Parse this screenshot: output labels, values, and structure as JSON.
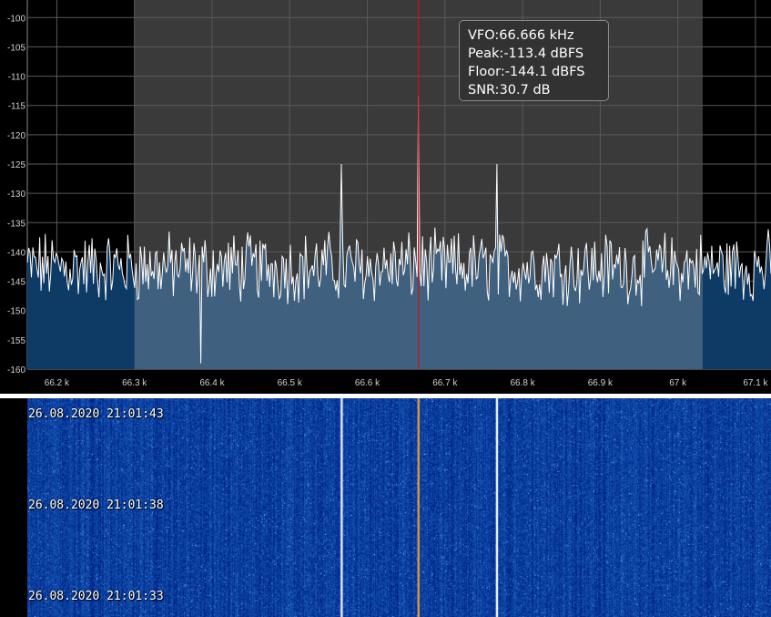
{
  "spectrum": {
    "y_ticks": [
      "-100",
      "-105",
      "-110",
      "-115",
      "-120",
      "-125",
      "-130",
      "-135",
      "-140",
      "-145",
      "-150",
      "-155",
      "-160"
    ],
    "x_ticks": [
      "66.2 k",
      "66.3 k",
      "66.4 k",
      "66.5 k",
      "66.6 k",
      "66.7 k",
      "66.8 k",
      "66.9 k",
      "67 k",
      "67.1 k"
    ],
    "y_range_dbfs": [
      -160,
      -97
    ],
    "x_range_khz": [
      66.162,
      67.12
    ],
    "filter_passband_khz": [
      66.3,
      67.032
    ],
    "vfo_marker_khz": 66.666,
    "spikes": [
      {
        "freq_khz": 66.567,
        "level_dbfs": -125.0
      },
      {
        "freq_khz": 66.666,
        "level_dbfs": -113.4
      },
      {
        "freq_khz": 66.767,
        "level_dbfs": -125.0
      },
      {
        "freq_khz": 66.386,
        "level_dbfs": -159.0
      }
    ],
    "noise_floor_dbfs": -144.1,
    "colors": {
      "background": "#000000",
      "passband": "#3a3a3a",
      "fill_outside": "#0e3a66",
      "fill_passband": "#3f607f",
      "trace": "#ffffff",
      "grid": "#5a5a5a",
      "marker": "#d01010"
    }
  },
  "vfo_info": {
    "vfo": "VFO:66.666 kHz",
    "peak": "Peak:-113.4 dBFS",
    "floor": "Floor:-144.1 dBFS",
    "snr": "SNR:30.7 dB"
  },
  "waterfall": {
    "timestamps": [
      "26.08.2020 21:01:43",
      "26.08.2020 21:01:38",
      "26.08.2020 21:01:33"
    ],
    "colors": {
      "background": "#0a1a8f",
      "signal": "#ffffff",
      "marker": "#f0a040"
    }
  }
}
